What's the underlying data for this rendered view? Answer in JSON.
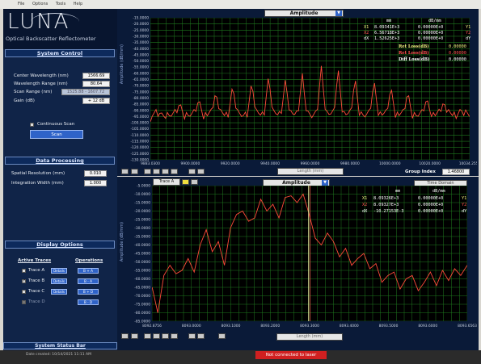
{
  "menu": [
    "File",
    "Options",
    "Tools",
    "Help"
  ],
  "logo": {
    "text": "LUNA",
    "subtitle": "Optical Backscatter Reflectometer"
  },
  "system_control": {
    "title": "System Control",
    "center_wavelength_label": "Center Wavelength (nm)",
    "center_wavelength_value": "1566.69",
    "wavelength_range_label": "Wavelength Range (nm)",
    "wavelength_range_value": "80.64",
    "scan_range_label": "Scan Range (nm)",
    "scan_range_value": "1525.88 - 1607.72",
    "gain_label": "Gain (dB)",
    "gain_value": "+ 12 dB",
    "continuous_scan_label": "Continuous Scan",
    "scan_button": "Scan"
  },
  "data_processing": {
    "title": "Data Processing",
    "spatial_resolution_label": "Spatial Resolution (mm)",
    "spatial_resolution_value": "0.010",
    "integration_width_label": "Integration Width (mm)",
    "integration_width_value": "1.000"
  },
  "display_options": {
    "title": "Display Options",
    "active_traces_label": "Active Traces",
    "operations_label": "Operations",
    "traces": [
      {
        "name": "Trace A",
        "checked": false,
        "op": "B + A"
      },
      {
        "name": "Trace B",
        "checked": true,
        "op": "B - A"
      },
      {
        "name": "Trace C",
        "checked": false,
        "op": "B + D"
      },
      {
        "name": "Trace D",
        "checked": false,
        "op": "B - D"
      }
    ],
    "details_label": "Details"
  },
  "system_status_bar": "System Status Bar",
  "bottom_status": {
    "date_text": "Date created: 10/14/2021 11:11 AM",
    "alert_text": "Not connected to laser"
  },
  "top_graph": {
    "title_select": "Amplitude",
    "y_axis_label": "Amplitude (dB/mm)",
    "x_axis_select": "Length (mm)",
    "group_index_label": "Group Index",
    "group_index_value": "1.46800",
    "cursor_header_mm": "mm",
    "cursor_header_db": "dB/mm",
    "cursors": [
      {
        "label": "X1",
        "mm": "8.09341E+3",
        "db": "0.00000E+0",
        "tag": "Y1"
      },
      {
        "label": "X2",
        "mm": "6.56718E+3",
        "db": "0.00000E+0",
        "tag": "Y2"
      },
      {
        "label": "dX",
        "mm": "1.52625E+3",
        "db": "0.00000E+0",
        "tag": "dY"
      }
    ],
    "ret_loss_1_label": "Ret Loss(dB)",
    "ret_loss_1_value": "0.00000",
    "ret_loss_2_label": "Ret Loss(dB)",
    "ret_loss_2_value": "0.00000",
    "diff_loss_label": "Diff Loss(dB)",
    "diff_loss_value": "0.00000"
  },
  "bottom_graph": {
    "trace_select": "Trace A",
    "title_select": "Amplitude",
    "domain_select": "Time Domain",
    "y_axis_label": "Amplitude (dB/mm)",
    "x_axis_select": "Length (mm)",
    "cursor_header_mm": "mm",
    "cursor_header_db": "dB/mm",
    "cursors": [
      {
        "label": "X1",
        "mm": "8.09326E+3",
        "db": "0.00000E+0",
        "tag": "Y1"
      },
      {
        "label": "X2",
        "mm": "8.09327E+3",
        "db": "0.00000E+0",
        "tag": "Y2"
      },
      {
        "label": "dX",
        "mm": "-10.27153E-3",
        "db": "0.00000E+0",
        "tag": "dY"
      }
    ]
  },
  "colors": {
    "trace": "#ff4a3a",
    "grid": "#1f7a1f",
    "cursor_x1": "#e8e8a0",
    "panel": "#102448"
  },
  "chart_data": [
    {
      "type": "line",
      "title": "Amplitude",
      "xlabel": "Length (mm)",
      "ylabel": "Amplitude (dB/mm)",
      "xlim": [
        9883.0,
        10034.3
      ],
      "ylim": [
        -130,
        -15
      ],
      "x_ticks": [
        "9883.0300",
        "9900.0000",
        "9920.0000",
        "9940.0000",
        "9960.0000",
        "9980.0000",
        "10000.0000",
        "10020.0000",
        "10034.2555"
      ],
      "y_ticks": [
        "-15.0000",
        "-20.0000",
        "-25.0000",
        "-30.0000",
        "-35.0000",
        "-40.0000",
        "-45.0000",
        "-50.0000",
        "-55.0000",
        "-60.0000",
        "-65.0000",
        "-70.0000",
        "-75.0000",
        "-80.0000",
        "-85.0000",
        "-90.0000",
        "-95.0000",
        "-100.0000",
        "-105.0000",
        "-110.0000",
        "-115.0000",
        "-120.0000",
        "-125.0000",
        "-130.0000"
      ],
      "grid": true,
      "series": [
        {
          "peaks_x": [
            9888,
            9897,
            9906,
            9914,
            9922,
            9931,
            9939,
            9947,
            9955,
            9964,
            9972,
            9980,
            9989,
            9997,
            10005,
            10014,
            10022,
            10030
          ],
          "peaks_y": [
            -91,
            -83,
            -80,
            -74,
            -69,
            -66,
            -61,
            -64,
            -60,
            -54,
            -56,
            -63,
            -65,
            -70,
            -74,
            -79,
            -82,
            -88
          ],
          "baseline": -97
        }
      ]
    },
    {
      "type": "line",
      "title": "Amplitude",
      "xlabel": "Length (mm)",
      "ylabel": "Amplitude (dB/mm)",
      "xlim": [
        8092.8756,
        8093.6563
      ],
      "ylim": [
        -85,
        -5
      ],
      "x_ticks": [
        "8092.8756",
        "8093.0000",
        "8093.1000",
        "8093.2000",
        "8093.3000",
        "8093.4000",
        "8093.5000",
        "8093.6000",
        "8093.6563"
      ],
      "y_ticks": [
        "-5.0000",
        "-10.0000",
        "-15.0000",
        "-20.0000",
        "-25.0000",
        "-30.0000",
        "-35.0000",
        "-40.0000",
        "-45.0000",
        "-50.0000",
        "-55.0000",
        "-60.0000",
        "-65.0000",
        "-70.0000",
        "-75.0000",
        "-80.0000",
        "-85.0000"
      ],
      "grid": true,
      "series": [
        {
          "x": [
            8092.876,
            8092.89,
            8092.905,
            8092.92,
            8092.935,
            8092.95,
            8092.965,
            8092.98,
            8092.995,
            8093.01,
            8093.025,
            8093.04,
            8093.055,
            8093.07,
            8093.085,
            8093.1,
            8093.115,
            8093.13,
            8093.145,
            8093.16,
            8093.175,
            8093.19,
            8093.205,
            8093.22,
            8093.235,
            8093.25,
            8093.265,
            8093.28,
            8093.295,
            8093.31,
            8093.325,
            8093.34,
            8093.355,
            8093.37,
            8093.385,
            8093.4,
            8093.415,
            8093.43,
            8093.445,
            8093.46,
            8093.475,
            8093.49,
            8093.505,
            8093.52,
            8093.535,
            8093.55,
            8093.565,
            8093.58,
            8093.595,
            8093.61,
            8093.625,
            8093.64,
            8093.656
          ],
          "y": [
            -65,
            -80,
            -58,
            -52,
            -57,
            -55,
            -48,
            -56,
            -40,
            -31,
            -44,
            -38,
            -52,
            -30,
            -22,
            -20,
            -26,
            -24,
            -13,
            -20,
            -16,
            -24,
            -12,
            -11,
            -15,
            -10,
            -22,
            -36,
            -40,
            -33,
            -38,
            -47,
            -42,
            -52,
            -48,
            -45,
            -54,
            -51,
            -62,
            -58,
            -56,
            -66,
            -60,
            -58,
            -67,
            -62,
            -56,
            -64,
            -55,
            -61,
            -54,
            -58,
            -52
          ]
        }
      ],
      "cursor_x": 8093.2633
    }
  ]
}
